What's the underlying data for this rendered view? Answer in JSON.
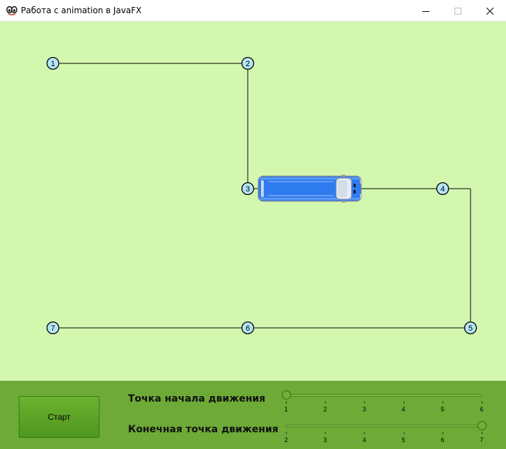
{
  "window": {
    "title": "Работа с animation в JavaFX",
    "minimize_icon": "minimize-icon",
    "maximize_icon": "maximize-icon",
    "close_icon": "close-icon"
  },
  "colors": {
    "canvas_bg": "#d4f7b0",
    "panel_bg": "#6eaa37",
    "node_fill": "#b3e6f5",
    "bus_body": "#2f7cf0"
  },
  "path": {
    "nodes": [
      {
        "label": "1"
      },
      {
        "label": "2"
      },
      {
        "label": "3"
      },
      {
        "label": "4"
      },
      {
        "label": "5"
      },
      {
        "label": "6"
      },
      {
        "label": "7"
      }
    ]
  },
  "vehicle": {
    "icon": "bus-icon"
  },
  "controls": {
    "start_button": "Старт",
    "start_point_label": "Точка начала движения",
    "end_point_label": "Конечная точка движения",
    "start_slider": {
      "min": 1,
      "max": 6,
      "value": 1,
      "ticks": [
        "1",
        "2",
        "3",
        "4",
        "5",
        "6"
      ]
    },
    "end_slider": {
      "min": 2,
      "max": 7,
      "value": 7,
      "ticks": [
        "2",
        "3",
        "4",
        "5",
        "6",
        "7"
      ]
    }
  }
}
